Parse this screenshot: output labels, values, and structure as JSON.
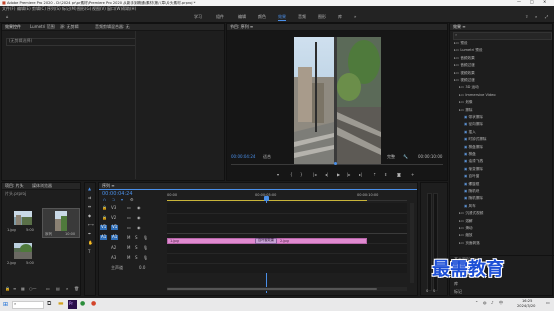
{
  "titlebar": {
    "text": "Adobe Premiere Pro 2020 - D:\\2024 pr\\pr素材\\Premiere Pro 2020 从新手到精通\\素材\\第八章\\片头素材.prproj *",
    "controls": [
      "—",
      "□",
      "✕"
    ]
  },
  "menu": [
    "文件(F)",
    "编辑(E)",
    "剪辑(C)",
    "序列(S)",
    "标记(M)",
    "图形(G)",
    "视图(V)",
    "窗口(W)",
    "帮助(H)"
  ],
  "workspaces": [
    "学习",
    "组件",
    "编辑",
    "颜色",
    "效果",
    "音频",
    "图形",
    "库",
    "»"
  ],
  "active_workspace": "效果",
  "source_panel": {
    "tabs": [
      "效果控件",
      "Lumetri 范围",
      "源: 无剪辑",
      "音频剪辑混合器: 无"
    ],
    "content": "(无剪辑选择)"
  },
  "program_panel": {
    "tab": "节目: 序列 ≡",
    "timecode_left": "00:00:04:24",
    "fit": "适合",
    "quality": "完整",
    "timecode_right": "00:00:10:00"
  },
  "effects_panel": {
    "tab": "效果 ≡",
    "items": [
      {
        "label": "预设",
        "depth": 1,
        "folder": true
      },
      {
        "label": "Lumetri 预设",
        "depth": 1,
        "folder": true
      },
      {
        "label": "音频效果",
        "depth": 1,
        "folder": true
      },
      {
        "label": "音频过渡",
        "depth": 1,
        "folder": true
      },
      {
        "label": "视频效果",
        "depth": 1,
        "folder": true
      },
      {
        "label": "视频过渡",
        "depth": 1,
        "folder": true
      },
      {
        "label": "3D 运动",
        "depth": 2,
        "folder": true
      },
      {
        "label": "Immersive Video",
        "depth": 2,
        "folder": true
      },
      {
        "label": "划像",
        "depth": 2,
        "folder": true
      },
      {
        "label": "擦除",
        "depth": 2,
        "folder": true
      },
      {
        "label": "带状擦除",
        "depth": 3,
        "folder": false
      },
      {
        "label": "径向擦除",
        "depth": 3,
        "folder": false
      },
      {
        "label": "插入",
        "depth": 3,
        "folder": false
      },
      {
        "label": "时钟式擦除",
        "depth": 3,
        "folder": false
      },
      {
        "label": "棋盘擦除",
        "depth": 3,
        "folder": false
      },
      {
        "label": "棋盘",
        "depth": 3,
        "folder": false
      },
      {
        "label": "油漆飞溅",
        "depth": 3,
        "folder": false
      },
      {
        "label": "渐变擦除",
        "depth": 3,
        "folder": false
      },
      {
        "label": "百叶窗",
        "depth": 3,
        "folder": false
      },
      {
        "label": "螺旋框",
        "depth": 3,
        "folder": false
      },
      {
        "label": "随机块",
        "depth": 3,
        "folder": false
      },
      {
        "label": "随机擦除",
        "depth": 3,
        "folder": false
      },
      {
        "label": "风车",
        "depth": 3,
        "folder": false
      },
      {
        "label": "沉浸式视频",
        "depth": 2,
        "folder": true
      },
      {
        "label": "溶解",
        "depth": 2,
        "folder": true
      },
      {
        "label": "滑动",
        "depth": 2,
        "folder": true
      },
      {
        "label": "缩放",
        "depth": 2,
        "folder": true
      },
      {
        "label": "页面剥落",
        "depth": 2,
        "folder": true
      }
    ],
    "bottom_tabs": [
      "基本图形",
      "基本声音",
      "Lumetri 颜色",
      "库",
      "标记"
    ]
  },
  "project_panel": {
    "tabs": [
      "项目: 片头",
      "媒体浏览器"
    ],
    "file": "片头.prproj",
    "clips": [
      {
        "name": "1.jpg",
        "duration": "5:00"
      },
      {
        "name": "序列",
        "duration": "10:00"
      },
      {
        "name": "2.jpg",
        "duration": "5:00"
      }
    ]
  },
  "timeline": {
    "tab": "序列 ≡",
    "timecode": "00:00:04:24",
    "ruler": [
      "00:00",
      "00:00:05:00",
      "00:00:10:00"
    ],
    "tracks": [
      "V3",
      "V2",
      "V1",
      "A1",
      "A2",
      "A3",
      "主声道"
    ],
    "master_value": "0.0",
    "clip_left": "1.jpg",
    "transition": "百叶窗效果",
    "clip_right": "2.jpg"
  },
  "taskbar": {
    "time": "16:25",
    "date": "2024/3/20"
  },
  "watermark": "最需教育"
}
